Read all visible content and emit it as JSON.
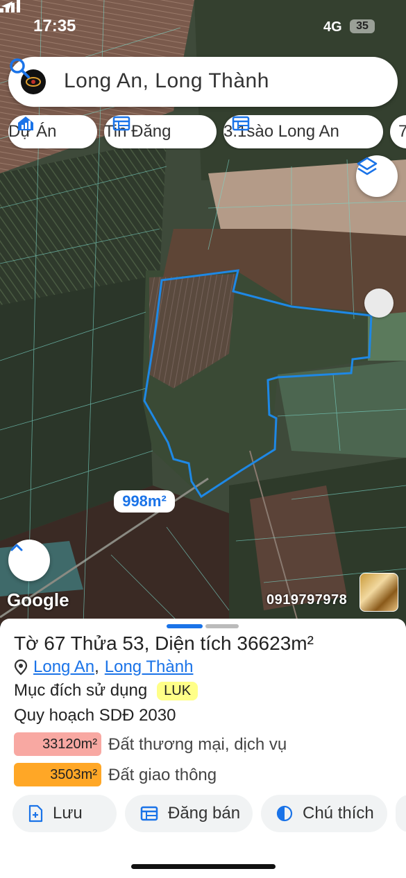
{
  "status_bar": {
    "time": "17:35",
    "network": "4G",
    "battery": "35"
  },
  "search": {
    "query": "Long An, Long Thành"
  },
  "chips": [
    {
      "label": "Dự Án",
      "icon": "home-chart-icon"
    },
    {
      "label": "Tin Đăng",
      "icon": "table-icon"
    },
    {
      "label": "3.1sào Long An",
      "icon": "table-icon"
    },
    {
      "label": "7",
      "icon": ""
    }
  ],
  "map": {
    "area_label": "998m²",
    "attribution": "Google",
    "phone": "0919797978",
    "parcel_color": "#1e88e5"
  },
  "sheet": {
    "title": "Tờ 67 Thửa 53, Diện tích 36623m²",
    "location_parts": [
      "Long An",
      "Long Thành"
    ],
    "location_sep": ",",
    "purpose_label": "Mục đích sử dụng",
    "purpose_badge": "LUK",
    "plan_label": "Quy hoạch SDĐ 2030",
    "zones": [
      {
        "area": "33120m²",
        "label": "Đất thương mại, dịch vụ",
        "color": "#f8a8a2"
      },
      {
        "area": "3503m²",
        "label": "Đất giao thông",
        "color": "#ffa726"
      }
    ],
    "actions": [
      {
        "label": "Lưu",
        "icon": "save-plus-icon"
      },
      {
        "label": "Đăng bán",
        "icon": "table-icon"
      },
      {
        "label": "Chú thích",
        "icon": "half-circle-icon"
      }
    ]
  }
}
